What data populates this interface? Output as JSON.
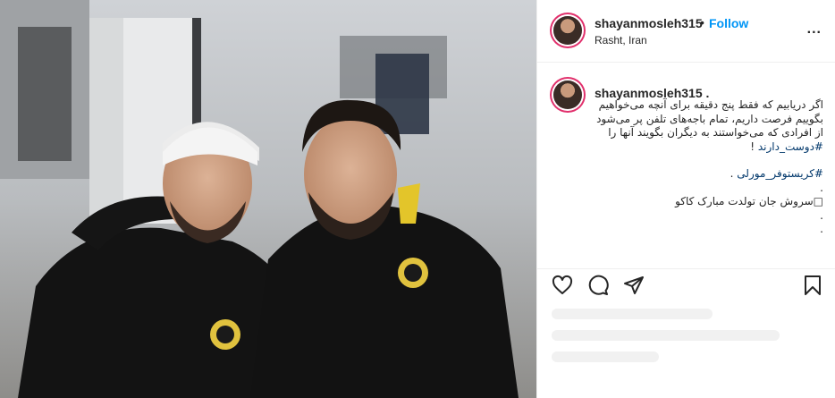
{
  "post": {
    "username": "shayanmosleh315",
    "separator": "•",
    "follow_label": "Follow",
    "location": "Rasht, Iran",
    "more_label": "..."
  },
  "caption": {
    "username": "shayanmosleh315",
    "suffix": ".",
    "line1": "اگر دریابیم که فقط پنج دقیقه برای آنچه می‌خواهیم",
    "line2": "بگوییم فرصت داریم، تمام باجه‌های تلفن پر می‌شود",
    "line3": "از افرادی که می‌خواستند به دیگران بگویند آنها را",
    "hashtag1": "#دوست_دارند",
    "hashtag1_suffix": " !",
    "hashtag2": "#کریستوفر_مورلی",
    "hashtag2_suffix": " .",
    "dot1": ".",
    "line_birthday": "سروش جان تولدت مبارک کاکو",
    "birthday_emoji": "□",
    "dot2": ".",
    "dot3": "."
  },
  "icons": {
    "like": "heart-icon",
    "comment": "comment-icon",
    "share": "paper-plane-icon",
    "save": "bookmark-icon",
    "more": "more-icon"
  },
  "colors": {
    "follow": "#0095f6",
    "hashtag": "#00376b",
    "text": "#262626"
  }
}
